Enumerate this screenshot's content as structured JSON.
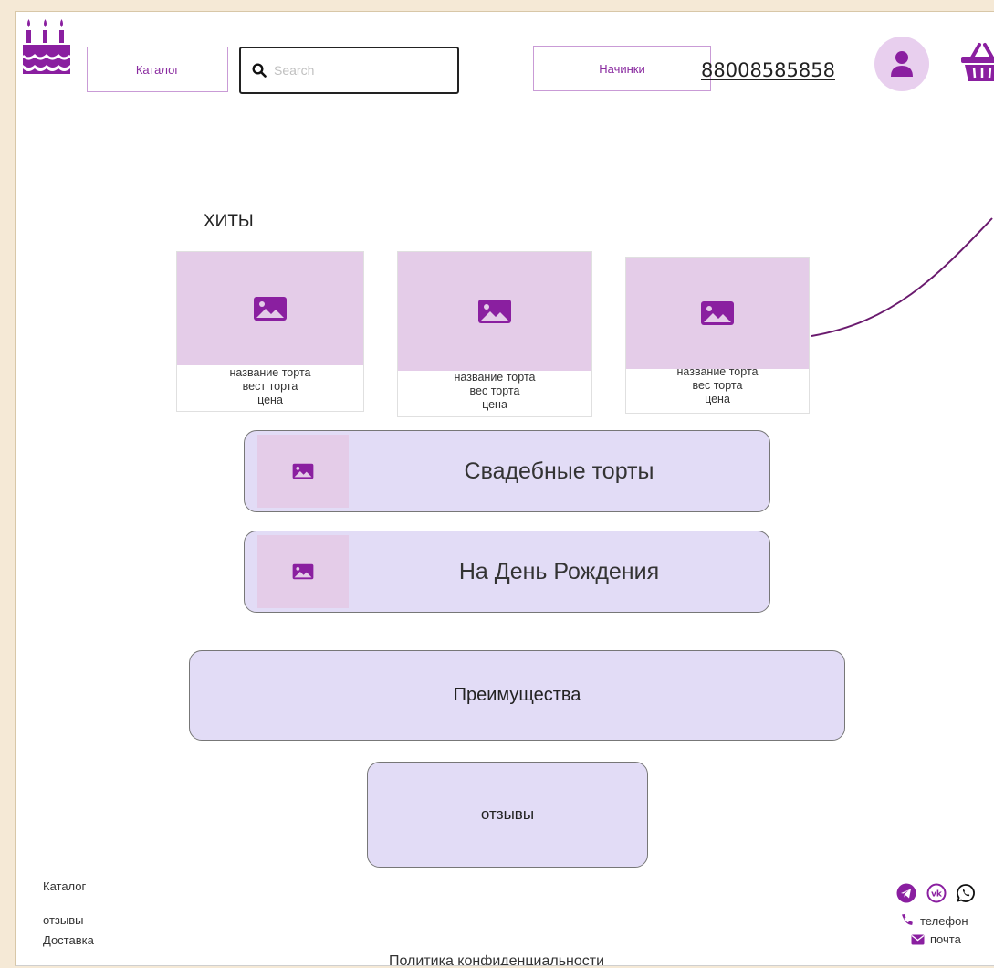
{
  "header": {
    "catalog_label": "Каталог",
    "search_placeholder": "Search",
    "fillings_label": "Начинки",
    "phone": "88008585858"
  },
  "hits": {
    "title": "ХИТЫ",
    "cards": [
      {
        "name": "название торта",
        "weight": "вест торта",
        "price": "цена"
      },
      {
        "name": "название торта",
        "weight": "вес торта",
        "price": "цена"
      },
      {
        "name": "название торта",
        "weight": "вес торта",
        "price": "цена"
      }
    ]
  },
  "categories": [
    {
      "label": "Свадебные торты"
    },
    {
      "label": "На День Рождения"
    }
  ],
  "advantages_label": "Преимущества",
  "reviews_label": "отзывы",
  "footer": {
    "links": [
      "Каталог",
      "отзывы",
      "Доставка"
    ],
    "policy": "Политика конфиденциальности",
    "phone_label": "телефон",
    "mail_label": "почта"
  },
  "colors": {
    "brand": "#8a1fa0",
    "accent_light": "#e4cce8",
    "block_bg": "#e2dcf6"
  },
  "icons": [
    "cake-logo-icon",
    "search-icon",
    "user-icon",
    "basket-icon",
    "image-icon",
    "telegram-icon",
    "vk-icon",
    "whatsapp-icon",
    "phone-icon",
    "mail-icon"
  ]
}
